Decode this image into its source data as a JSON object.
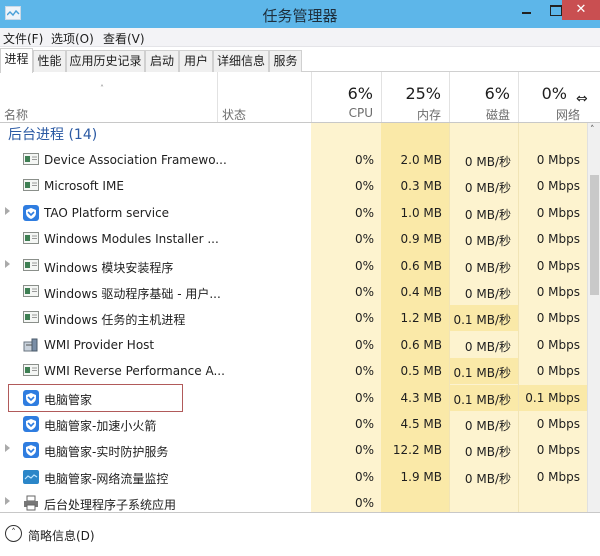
{
  "window": {
    "title": "任务管理器",
    "app_icon": "task-manager-icon",
    "minimize_icon": "minimize-icon",
    "maximize_icon": "maximize-icon",
    "close_glyph": "✕"
  },
  "menu": [
    {
      "label": "文件(F)"
    },
    {
      "label": "选项(O)"
    },
    {
      "label": "查看(V)"
    }
  ],
  "tabs": [
    {
      "label": "进程",
      "active": true
    },
    {
      "label": "性能"
    },
    {
      "label": "应用历史记录"
    },
    {
      "label": "启动"
    },
    {
      "label": "用户"
    },
    {
      "label": "详细信息"
    },
    {
      "label": "服务"
    }
  ],
  "columns": {
    "name": {
      "label": "名称",
      "sort_arrow": "˄"
    },
    "status": {
      "label": "状态"
    },
    "cpu": {
      "percent": "6%",
      "label": "CPU"
    },
    "memory": {
      "percent": "25%",
      "label": "内存"
    },
    "disk": {
      "percent": "6%",
      "label": "磁盘"
    },
    "network": {
      "percent": "0%",
      "label": "网络"
    }
  },
  "group": {
    "label": "后台进程 (14)"
  },
  "rows": [
    {
      "name": "Device Association Framewo...",
      "icon": "app-window-icon",
      "expandable": false,
      "cpu": "0%",
      "memory": "2.0 MB",
      "disk": "0 MB/秒",
      "network": "0 Mbps"
    },
    {
      "name": "Microsoft IME",
      "icon": "app-window-icon",
      "expandable": false,
      "cpu": "0%",
      "memory": "0.3 MB",
      "disk": "0 MB/秒",
      "network": "0 Mbps"
    },
    {
      "name": "TAO Platform service",
      "icon": "shield-icon",
      "expandable": true,
      "cpu": "0%",
      "memory": "1.0 MB",
      "disk": "0 MB/秒",
      "network": "0 Mbps"
    },
    {
      "name": "Windows Modules Installer ...",
      "icon": "app-window-icon",
      "expandable": false,
      "cpu": "0%",
      "memory": "0.9 MB",
      "disk": "0 MB/秒",
      "network": "0 Mbps"
    },
    {
      "name": "Windows 模块安装程序",
      "icon": "app-window-icon",
      "expandable": true,
      "cpu": "0%",
      "memory": "0.6 MB",
      "disk": "0 MB/秒",
      "network": "0 Mbps"
    },
    {
      "name": "Windows 驱动程序基础 - 用户...",
      "icon": "app-window-icon",
      "expandable": false,
      "cpu": "0%",
      "memory": "0.4 MB",
      "disk": "0 MB/秒",
      "network": "0 Mbps"
    },
    {
      "name": "Windows 任务的主机进程",
      "icon": "app-window-icon",
      "expandable": false,
      "cpu": "0%",
      "memory": "1.2 MB",
      "disk": "0.1 MB/秒",
      "network": "0 Mbps"
    },
    {
      "name": "WMI Provider Host",
      "icon": "wmi-host-icon",
      "expandable": false,
      "cpu": "0%",
      "memory": "0.6 MB",
      "disk": "0 MB/秒",
      "network": "0 Mbps"
    },
    {
      "name": "WMI Reverse Performance A...",
      "icon": "app-window-icon",
      "expandable": false,
      "cpu": "0%",
      "memory": "0.5 MB",
      "disk": "0.1 MB/秒",
      "network": "0 Mbps"
    },
    {
      "name": "电脑管家",
      "icon": "shield-icon",
      "expandable": false,
      "selected": true,
      "cpu": "0%",
      "memory": "4.3 MB",
      "disk": "0.1 MB/秒",
      "network": "0.1 Mbps"
    },
    {
      "name": "电脑管家-加速小火箭",
      "icon": "shield-icon",
      "expandable": false,
      "cpu": "0%",
      "memory": "4.5 MB",
      "disk": "0 MB/秒",
      "network": "0 Mbps"
    },
    {
      "name": "电脑管家-实时防护服务",
      "icon": "shield-icon",
      "expandable": true,
      "cpu": "0%",
      "memory": "12.2 MB",
      "disk": "0 MB/秒",
      "network": "0 Mbps"
    },
    {
      "name": "电脑管家-网络流量监控",
      "icon": "network-monitor-icon",
      "expandable": false,
      "cpu": "0%",
      "memory": "1.9 MB",
      "disk": "0 MB/秒",
      "network": "0 Mbps"
    },
    {
      "name": "后台处理程序子系统应用",
      "icon": "printer-icon",
      "expandable": true,
      "cpu": "0%",
      "memory": "",
      "disk": "",
      "network": ""
    }
  ],
  "scrollbar": {
    "up_glyph": "˄"
  },
  "footer": {
    "label": "简略信息(D)",
    "toggle_glyph": "˄"
  },
  "colors": {
    "titlebar": "#5db6e9",
    "close": "#c94f51",
    "heat_light": "#fdf3cf",
    "heat_medium": "#fae9a8",
    "group_text": "#2a59a3",
    "selection_border": "#b15a5a"
  }
}
